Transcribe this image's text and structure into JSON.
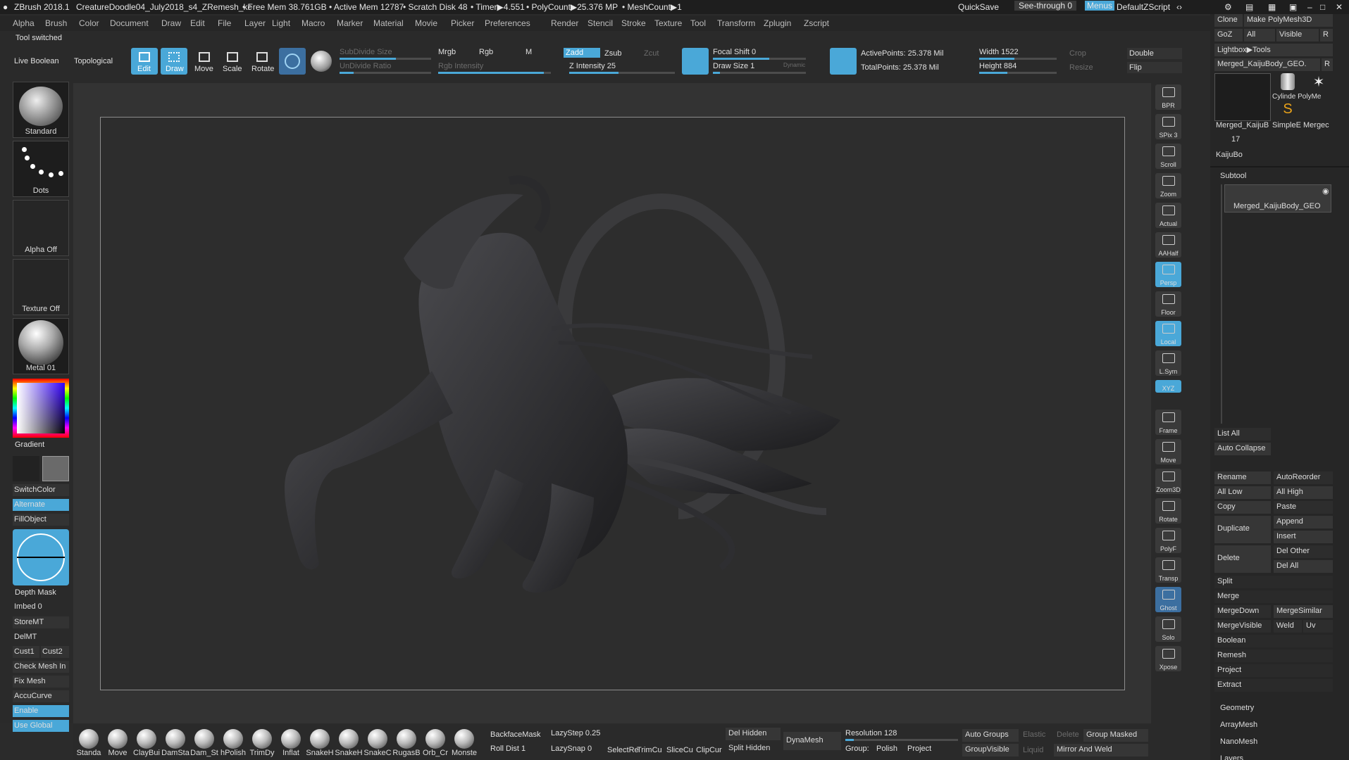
{
  "title": {
    "app": "ZBrush 2018.1",
    "doc": "CreatureDoodle04_July2018_s4_ZRemesh_kc",
    "free_mem": "• Free Mem 38.761GB",
    "active_mem": "• Active Mem 12787",
    "scratch": "• Scratch Disk 48",
    "timer": "• Timer▶4.551",
    "polycount": "• PolyCount▶25.376 MP",
    "meshcount": "• MeshCount▶1",
    "quicksave": "QuickSave",
    "seethrough": "See-through",
    "seethrough_val": "0",
    "menus": "Menus",
    "defaultzscript": "DefaultZScript"
  },
  "menus": [
    "Alpha",
    "Brush",
    "Color",
    "Document",
    "Draw",
    "Edit",
    "File",
    "Layer",
    "Light",
    "Macro",
    "Marker",
    "Material",
    "Movie",
    "Picker",
    "Preferences",
    "Render",
    "Stencil",
    "Stroke",
    "Texture",
    "Tool",
    "Transform",
    "Zplugin",
    "Zscript"
  ],
  "toolbar": {
    "status": "Tool switched",
    "live_boolean": "Live Boolean",
    "topological": "Topological",
    "edit": "Edit",
    "draw": "Draw",
    "move": "Move",
    "scale": "Scale",
    "rotate": "Rotate",
    "subdivide_size": "SubDivide Size",
    "undivide_ratio": "UnDivide Ratio",
    "mrgb": "Mrgb",
    "rgb": "Rgb",
    "m": "M",
    "rgb_intensity": "Rgb Intensity",
    "zadd": "Zadd",
    "zsub": "Zsub",
    "zcut": "Zcut",
    "z_intensity": "Z Intensity 25",
    "focal_shift": "Focal Shift 0",
    "draw_size": "Draw Size 1",
    "dynamic": "Dynamic",
    "active_points": "ActivePoints: 25.378 Mil",
    "total_points": "TotalPoints: 25.378 Mil",
    "width": "Width 1522",
    "height": "Height 884",
    "crop": "Crop",
    "resize": "Resize",
    "double": "Double",
    "flip": "Flip"
  },
  "left": {
    "standard": "Standard",
    "dots": "Dots",
    "alpha_off": "Alpha Off",
    "texture_off": "Texture Off",
    "metal": "Metal 01",
    "gradient": "Gradient",
    "switchcolor": "SwitchColor",
    "alternate": "Alternate",
    "fillobject": "FillObject",
    "depth_mask": "Depth Mask",
    "imbed": "Imbed 0",
    "storemt": "StoreMT",
    "delmt": "DelMT",
    "cust1": "Cust1",
    "cust2": "Cust2",
    "check_mesh": "Check Mesh In",
    "fix_mesh": "Fix Mesh",
    "accucurve": "AccuCurve",
    "enable": "Enable",
    "use_global": "Use Global"
  },
  "shelf": [
    "BPR",
    "SPix 3",
    "Scroll",
    "Zoom",
    "Actual",
    "AAHalf",
    "Persp",
    "Floor",
    "Local",
    "L.Sym",
    "XYZ",
    "Frame",
    "Move",
    "Zoom3D",
    "Rotate",
    "PolyF",
    "Transp",
    "Ghost",
    "Solo",
    "Xpose"
  ],
  "right": {
    "clone": "Clone",
    "make_polymesh": "Make PolyMesh3D",
    "goz": "GoZ",
    "all": "All",
    "visible": "Visible",
    "r": "R",
    "lightbox_tools": "Lightbox▶Tools",
    "merged_name": "Merged_KaijuBody_GEO.",
    "tool1": "Merged_KaijuB",
    "tool2": "Cylinde PolyMe",
    "tool3": "SimpleE",
    "tool4": "Mergec",
    "count": "17",
    "kaijubo": "KaijuBo",
    "subtool": "Subtool",
    "subtool_item": "Merged_KaijuBody_GEO",
    "list_all": "List All",
    "auto_collapse": "Auto Collapse",
    "rename": "Rename",
    "autoreorder": "AutoReorder",
    "all_low": "All Low",
    "all_high": "All High",
    "copy": "Copy",
    "paste": "Paste",
    "duplicate": "Duplicate",
    "append": "Append",
    "insert": "Insert",
    "delete": "Delete",
    "del_other": "Del Other",
    "del_all": "Del All",
    "split": "Split",
    "merge": "Merge",
    "mergedown": "MergeDown",
    "mergesimilar": "MergeSimilar",
    "mergevisible": "MergeVisible",
    "weld": "Weld",
    "uv": "Uv",
    "boolean": "Boolean",
    "remesh": "Remesh",
    "project": "Project",
    "extract": "Extract",
    "geometry": "Geometry",
    "arraymesh": "ArrayMesh",
    "nanomesh": "NanoMesh",
    "layers": "Layers"
  },
  "bottom": {
    "brushes": [
      "Standa",
      "Move",
      "ClayBui",
      "DamSta",
      "Dam_St",
      "hPolish",
      "TrimDy",
      "Inflat",
      "SnakeH",
      "SnakeH",
      "SnakeC",
      "RugasB",
      "Orb_Cr",
      "Monste"
    ],
    "backfacemask": "BackfaceMask",
    "lazystep": "LazyStep 0.25",
    "rolldist": "Roll Dist 1",
    "lazysnap": "LazySnap 0",
    "select": "SelectRe",
    "trimcu": "TrimCu",
    "slicecu": "SliceCu",
    "clipcur": "ClipCur",
    "del_hidden": "Del Hidden",
    "split_hidden": "Split Hidden",
    "dynamesh": "DynaMesh",
    "resolution": "Resolution 128",
    "group": "Group:",
    "polish": "Polish",
    "project": "Project",
    "auto_groups": "Auto Groups",
    "elastic": "Elastic",
    "delete": "Delete",
    "group_masked": "Group Masked",
    "groupvisible": "GroupVisible",
    "liquid": "Liquid",
    "mirror_weld": "Mirror And Weld"
  }
}
